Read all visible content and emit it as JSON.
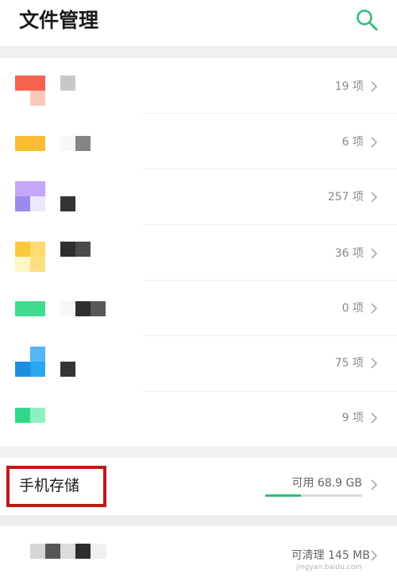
{
  "header": {
    "title": "文件管理",
    "search_icon": "search-icon"
  },
  "colors": {
    "accent": "#2bbf76",
    "highlight_border": "#c21818"
  },
  "categories": [
    {
      "count": "19 项",
      "icon": "category-icon-red"
    },
    {
      "count": "6 项",
      "icon": "category-icon-orange"
    },
    {
      "count": "257 项",
      "icon": "category-icon-purple"
    },
    {
      "count": "36 项",
      "icon": "category-icon-yellow"
    },
    {
      "count": "0 项",
      "icon": "category-icon-green"
    },
    {
      "count": "75 项",
      "icon": "category-icon-blue"
    },
    {
      "count": "9 项",
      "icon": "category-icon-teal"
    }
  ],
  "storage": {
    "label": "手机存储",
    "available": "可用 68.9 GB",
    "used_fraction": 0.37
  },
  "cleanup": {
    "text": "可清理 145 MB"
  },
  "watermark": {
    "text": "jingyan.baidu.com"
  }
}
